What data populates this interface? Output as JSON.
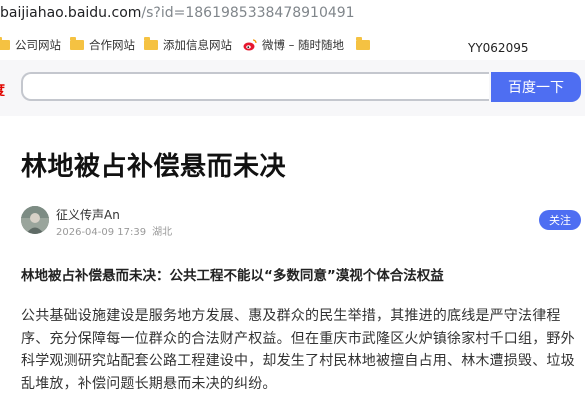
{
  "browser": {
    "url_host": "baijiahao.baidu.com",
    "url_path": "/s?id=1861985338478910491",
    "bookmarks": [
      {
        "label": "公司网站",
        "icon": "folder-icon"
      },
      {
        "label": "合作网站",
        "icon": "folder-icon"
      },
      {
        "label": "添加信息网站",
        "icon": "folder-icon"
      },
      {
        "label": "微博 – 随时随地",
        "icon": "weibo-icon"
      },
      {
        "label": "",
        "icon": "folder-icon"
      }
    ],
    "overlay_code": "YY062095"
  },
  "search": {
    "logo_fragment": "度",
    "button_label": "百度一下",
    "input_value": "",
    "accent": "#4e6ef2"
  },
  "article": {
    "title": "林地被占补偿悬而未决",
    "author": "征义传声An",
    "date": "2026-04-09 17:39",
    "location": "湖北",
    "follow_label": "关注",
    "subtitle": "林地被占补偿悬而未决：公共工程不能以“多数同意”漠视个体合法权益",
    "paragraph": "公共基础设施建设是服务地方发展、惠及群众的民生举措，其推进的底线是严守法律程序、充分保障每一位群众的合法财产权益。但在重庆市武隆区火炉镇徐家村千口组，野外科学观测研究站配套公路工程建设中，却发生了村民林地被擅自占用、林木遭损毁、垃圾乱堆放，补偿问题长期悬而未决的纠纷。"
  }
}
